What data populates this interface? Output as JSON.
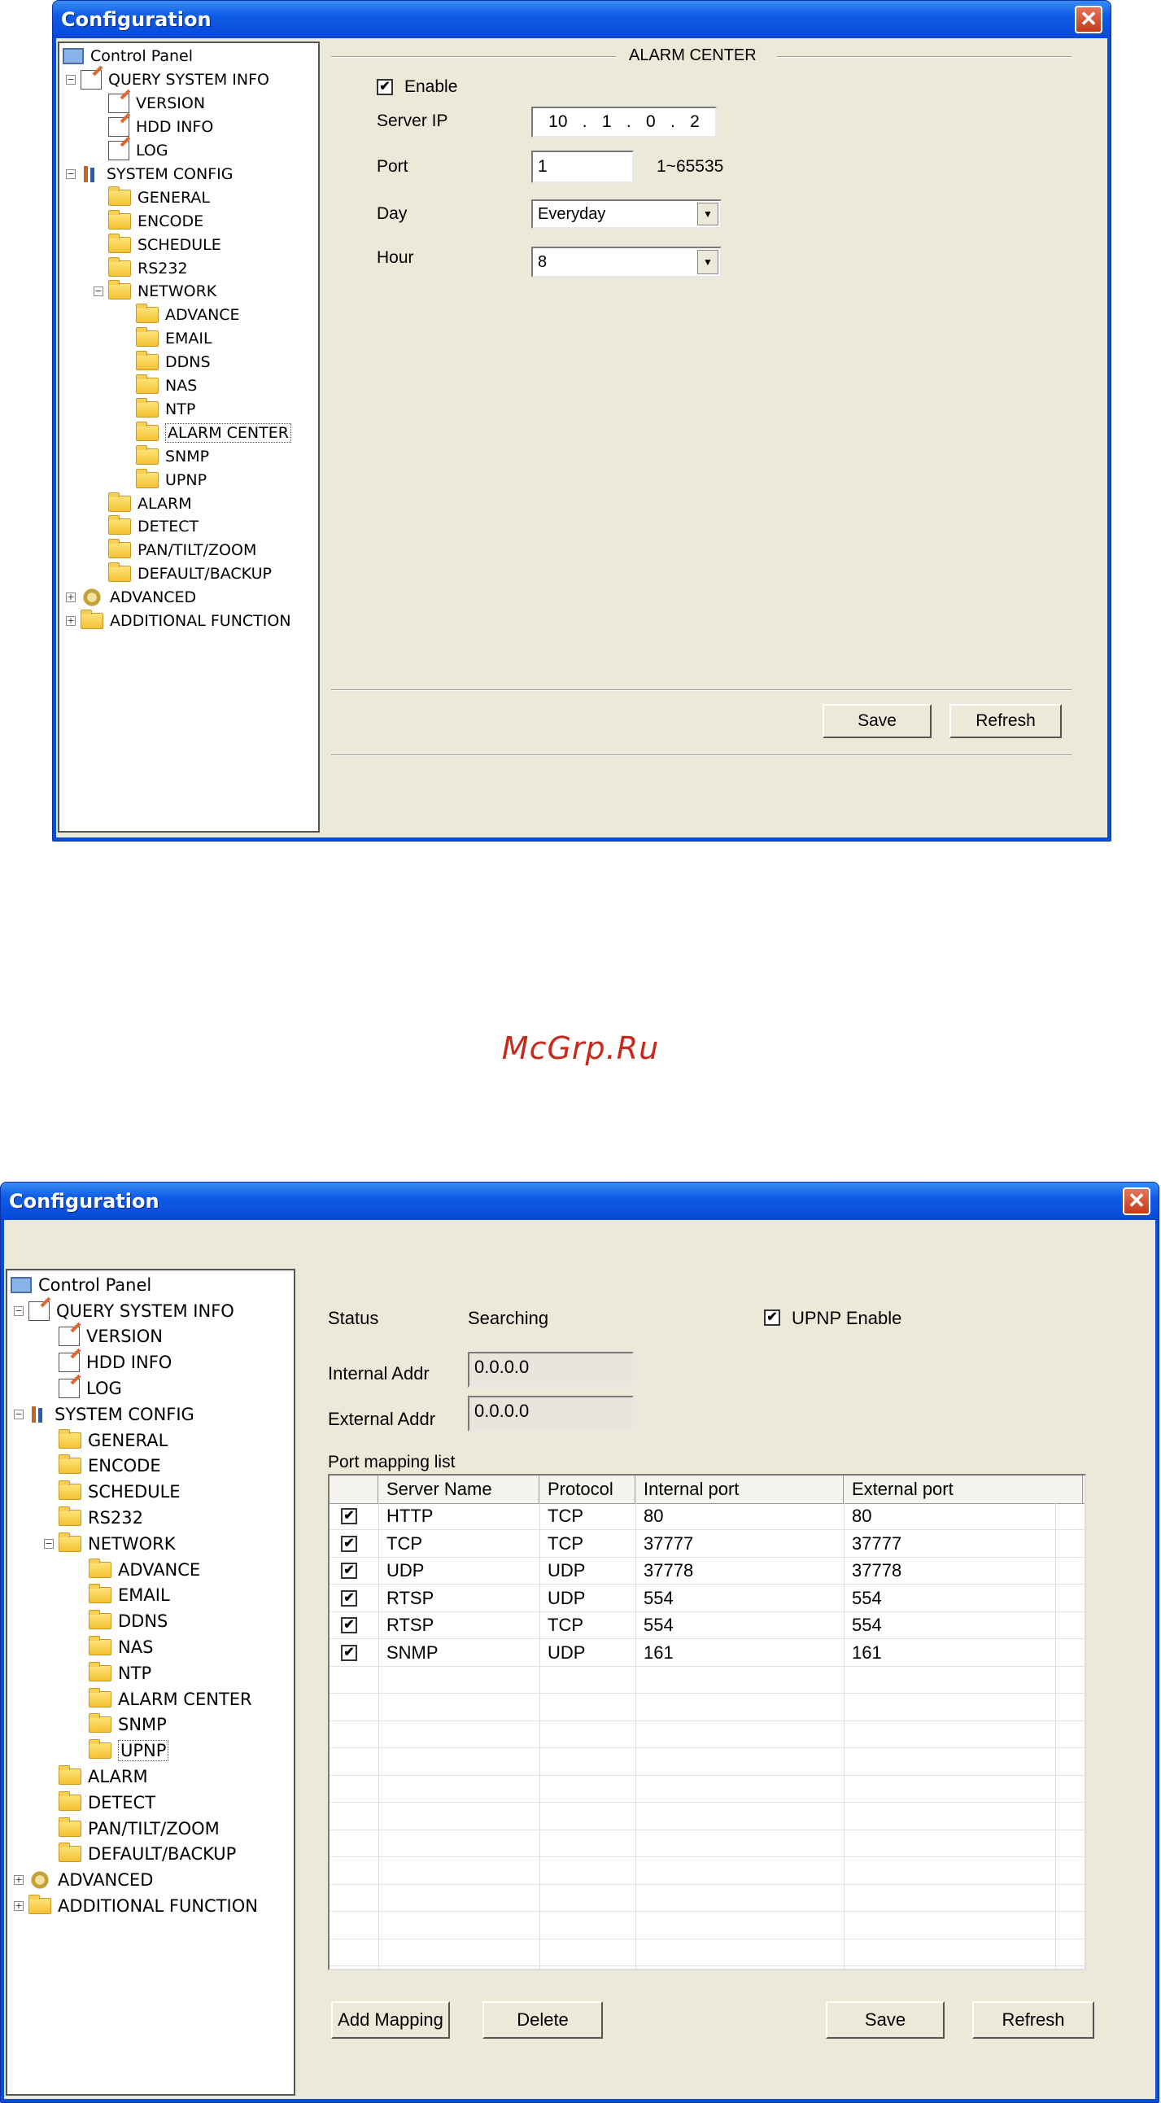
{
  "window1": {
    "title": "Configuration",
    "close_glyph": "✕",
    "tree": [
      {
        "label": "Control Panel",
        "icon": "monitor-icon",
        "level": 0
      },
      {
        "label": "QUERY SYSTEM INFO",
        "icon": "document-icon",
        "level": 1,
        "expander": "−"
      },
      {
        "label": "VERSION",
        "icon": "document-icon",
        "level": 2
      },
      {
        "label": "HDD INFO",
        "icon": "document-icon",
        "level": 2
      },
      {
        "label": "LOG",
        "icon": "document-icon",
        "level": 2
      },
      {
        "label": "SYSTEM CONFIG",
        "icon": "tools-icon",
        "level": 1,
        "expander": "−"
      },
      {
        "label": "GENERAL",
        "icon": "folder-icon",
        "level": 2
      },
      {
        "label": "ENCODE",
        "icon": "folder-icon",
        "level": 2
      },
      {
        "label": "SCHEDULE",
        "icon": "folder-icon",
        "level": 2
      },
      {
        "label": "RS232",
        "icon": "folder-icon",
        "level": 2
      },
      {
        "label": "NETWORK",
        "icon": "folder-icon",
        "level": 2,
        "expander": "−"
      },
      {
        "label": "ADVANCE",
        "icon": "folder-icon",
        "level": 3
      },
      {
        "label": "EMAIL",
        "icon": "folder-icon",
        "level": 3
      },
      {
        "label": "DDNS",
        "icon": "folder-icon",
        "level": 3
      },
      {
        "label": "NAS",
        "icon": "folder-icon",
        "level": 3
      },
      {
        "label": "NTP",
        "icon": "folder-icon",
        "level": 3
      },
      {
        "label": "ALARM CENTER",
        "icon": "folder-open-icon",
        "level": 3,
        "selected": true
      },
      {
        "label": "SNMP",
        "icon": "folder-icon",
        "level": 3
      },
      {
        "label": "UPNP",
        "icon": "folder-icon",
        "level": 3
      },
      {
        "label": "ALARM",
        "icon": "folder-icon",
        "level": 2
      },
      {
        "label": "DETECT",
        "icon": "folder-icon",
        "level": 2
      },
      {
        "label": "PAN/TILT/ZOOM",
        "icon": "folder-icon",
        "level": 2
      },
      {
        "label": "DEFAULT/BACKUP",
        "icon": "folder-icon",
        "level": 2
      },
      {
        "label": "ADVANCED",
        "icon": "gears-icon",
        "level": 1,
        "expander": "+"
      },
      {
        "label": "ADDITIONAL FUNCTION",
        "icon": "folder-icon",
        "level": 1,
        "expander": "+"
      }
    ],
    "panel": {
      "group_title": "ALARM CENTER",
      "enable_label": "Enable",
      "enable_checked": true,
      "check_glyph": "✔",
      "server_ip_label": "Server IP",
      "server_ip": [
        "10",
        "1",
        "0",
        "2"
      ],
      "ip_dot": ".",
      "port_label": "Port",
      "port_value": "1",
      "port_range": "1~65535",
      "day_label": "Day",
      "day_value": "Everyday",
      "hour_label": "Hour",
      "hour_value": "8",
      "dropdown_glyph": "▼",
      "save_label": "Save",
      "refresh_label": "Refresh"
    }
  },
  "watermark": "McGrp.Ru",
  "window2": {
    "title": "Configuration",
    "close_glyph": "✕",
    "tree_selected": "UPNP",
    "panel": {
      "status_label": "Status",
      "status_value": "Searching",
      "upnp_enable_label": "UPNP Enable",
      "upnp_enable_checked": true,
      "check_glyph": "✔",
      "internal_addr_label": "Internal Addr",
      "internal_addr_value": "0.0.0.0",
      "external_addr_label": "External Addr",
      "external_addr_value": "0.0.0.0",
      "port_mapping_label": "Port mapping list",
      "columns": [
        "",
        "Server Name",
        "Protocol",
        "Internal port",
        "External port"
      ],
      "rows": [
        {
          "checked": true,
          "server": "HTTP",
          "protocol": "TCP",
          "internal": "80",
          "external": "80"
        },
        {
          "checked": true,
          "server": "TCP",
          "protocol": "TCP",
          "internal": "37777",
          "external": "37777"
        },
        {
          "checked": true,
          "server": "UDP",
          "protocol": "UDP",
          "internal": "37778",
          "external": "37778"
        },
        {
          "checked": true,
          "server": "RTSP",
          "protocol": "UDP",
          "internal": "554",
          "external": "554"
        },
        {
          "checked": true,
          "server": "RTSP",
          "protocol": "TCP",
          "internal": "554",
          "external": "554"
        },
        {
          "checked": true,
          "server": "SNMP",
          "protocol": "UDP",
          "internal": "161",
          "external": "161"
        }
      ],
      "add_mapping_label": "Add Mapping",
      "delete_label": "Delete",
      "save_label": "Save",
      "refresh_label": "Refresh"
    }
  }
}
